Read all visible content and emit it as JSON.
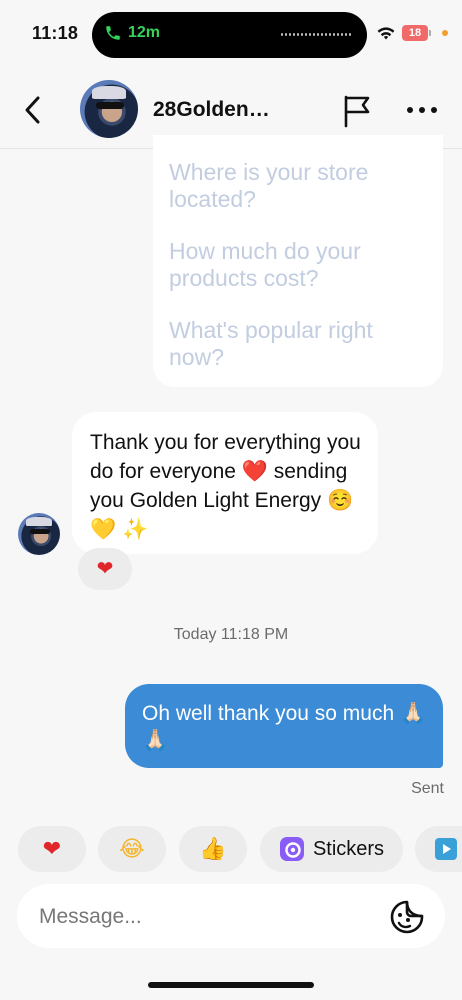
{
  "status": {
    "time": "11:18",
    "call_duration": "12m",
    "battery": "18"
  },
  "header": {
    "contact_name": "28Golden…"
  },
  "faq": {
    "items": [
      "Where is your store located?",
      "How much do your products cost?",
      "What's popular right now?"
    ]
  },
  "incoming": {
    "text": "Thank you for everything you do for everyone ❤️ sending you Golden Light Energy ☺️ 💛 ✨",
    "reaction": "❤"
  },
  "timestamp": "Today 11:18 PM",
  "outgoing": {
    "text": "Oh well thank you so much 🙏🏻🙏🏻",
    "status": "Sent"
  },
  "quick_actions": {
    "heart": "❤",
    "laugh": "😂",
    "thumbs": "👍",
    "stickers": "Stickers"
  },
  "composer": {
    "placeholder": "Message..."
  },
  "colors": {
    "outgoing_bubble": "#3b8bd6",
    "faq_text": "#c2cde0",
    "heart": "#e0252b",
    "call_green": "#35d35b"
  }
}
